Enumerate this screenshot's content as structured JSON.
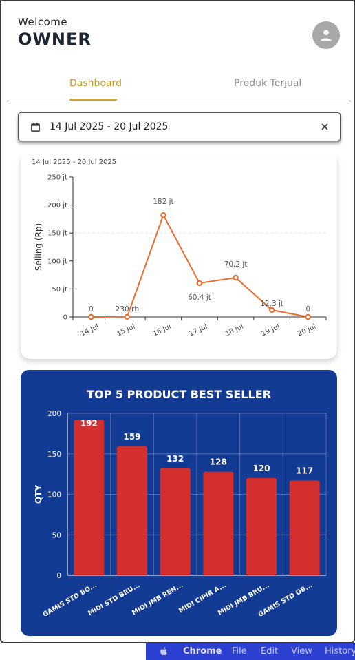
{
  "header": {
    "welcome": "Welcome",
    "user": "OWNER"
  },
  "tabs": [
    {
      "label": "Dashboard",
      "active": true
    },
    {
      "label": "Produk Terjual",
      "active": false
    }
  ],
  "date_range": {
    "value": "14 Jul 2025 - 20 Jul 2025"
  },
  "colors": {
    "accent": "#d4a52a",
    "line": "#ee6a2c",
    "card_blue": "#143b94",
    "bar_red": "#d32f2f"
  },
  "chart_data": [
    {
      "type": "line",
      "subtitle": "14 Jul 2025 - 20 Jul 2025",
      "ylabel": "Selling (Rp)",
      "categories": [
        "14 Jul",
        "15 Jul",
        "16 Jul",
        "17 Jul",
        "18 Jul",
        "19 Jul",
        "20 Jul"
      ],
      "values": [
        0,
        230000,
        182000000,
        60400000,
        70200000,
        12300000,
        0
      ],
      "data_labels": [
        "0",
        "230 rb",
        "182 jt",
        "60,4 jt",
        "70,2 jt",
        "12,3 jt",
        "0"
      ],
      "yticks": [
        0,
        50000000,
        100000000,
        150000000,
        200000000,
        250000000
      ],
      "ytick_labels": [
        "0",
        "50 jt",
        "100 jt",
        "150 jt",
        "200 jt",
        "250 jt"
      ],
      "ylim": [
        0,
        250000000
      ]
    },
    {
      "type": "bar",
      "title": "TOP 5 PRODUCT BEST SELLER",
      "ylabel": "QTY",
      "categories": [
        "GAMIS STD BO...",
        "MIDI STD BRU...",
        "MIDI JMB REN...",
        "MIDI CIPIR A...",
        "MIDI JMB BRU...",
        "GAMIS STD OB..."
      ],
      "values": [
        192,
        159,
        132,
        128,
        120,
        117
      ],
      "yticks": [
        0,
        50,
        100,
        150,
        200
      ],
      "ylim": [
        0,
        200
      ]
    }
  ],
  "menubar": {
    "apple": "",
    "items": [
      "Chrome",
      "File",
      "Edit",
      "View",
      "History"
    ]
  }
}
